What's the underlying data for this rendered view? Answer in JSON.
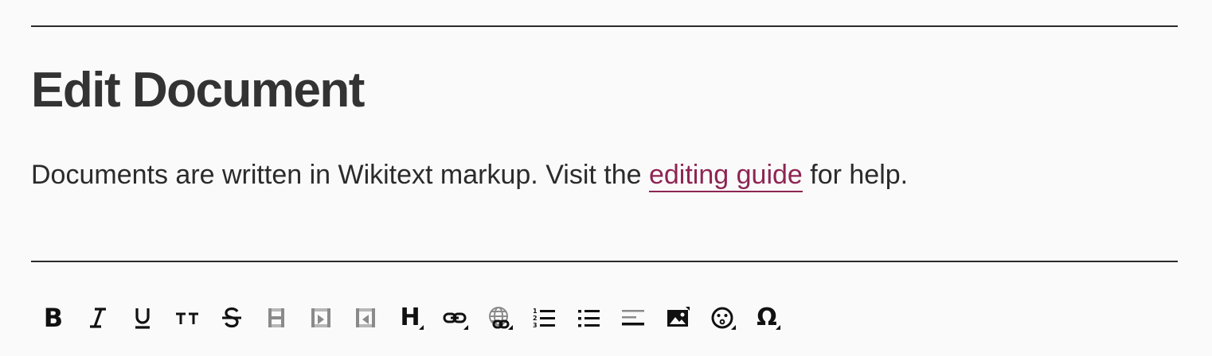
{
  "page": {
    "title": "Edit Document",
    "intro_before": "Documents are written in Wikitext markup. Visit the ",
    "intro_link": "editing guide",
    "intro_after": " for help."
  },
  "toolbar": {
    "buttons": [
      {
        "id": "bold",
        "icon": "bold-icon",
        "label": "B",
        "enabled": true
      },
      {
        "id": "italic",
        "icon": "italic-icon",
        "label": "I",
        "enabled": true
      },
      {
        "id": "underline",
        "icon": "underline-icon",
        "label": "U",
        "enabled": true
      },
      {
        "id": "small-caps",
        "icon": "small-caps-icon",
        "label": "TT",
        "enabled": true
      },
      {
        "id": "strikethrough",
        "icon": "strikethrough-icon",
        "label": "S",
        "enabled": true
      },
      {
        "id": "table",
        "icon": "table-icon",
        "enabled": false
      },
      {
        "id": "table-insert",
        "icon": "table-insert-icon",
        "enabled": false
      },
      {
        "id": "table-remove",
        "icon": "table-remove-icon",
        "enabled": false
      },
      {
        "id": "heading",
        "icon": "heading-icon",
        "label": "H",
        "enabled": true,
        "dropdown": true
      },
      {
        "id": "link",
        "icon": "link-icon",
        "enabled": true,
        "dropdown": true
      },
      {
        "id": "external-link",
        "icon": "globe-link-icon",
        "enabled": true,
        "dropdown": true
      },
      {
        "id": "ordered-list",
        "icon": "ordered-list-icon",
        "enabled": true
      },
      {
        "id": "unordered-list",
        "icon": "unordered-list-icon",
        "enabled": true
      },
      {
        "id": "align",
        "icon": "align-left-icon",
        "enabled": true
      },
      {
        "id": "image",
        "icon": "image-icon",
        "enabled": true,
        "dropdown": true
      },
      {
        "id": "emoji",
        "icon": "emoji-icon",
        "enabled": true,
        "dropdown": true
      },
      {
        "id": "special-chars",
        "icon": "omega-icon",
        "label": "Ω",
        "enabled": true,
        "dropdown": true
      }
    ]
  },
  "colors": {
    "text": "#2b2b2b",
    "link": "#8e2553",
    "disabled": "#8a8a8a",
    "background": "#fafafa"
  }
}
